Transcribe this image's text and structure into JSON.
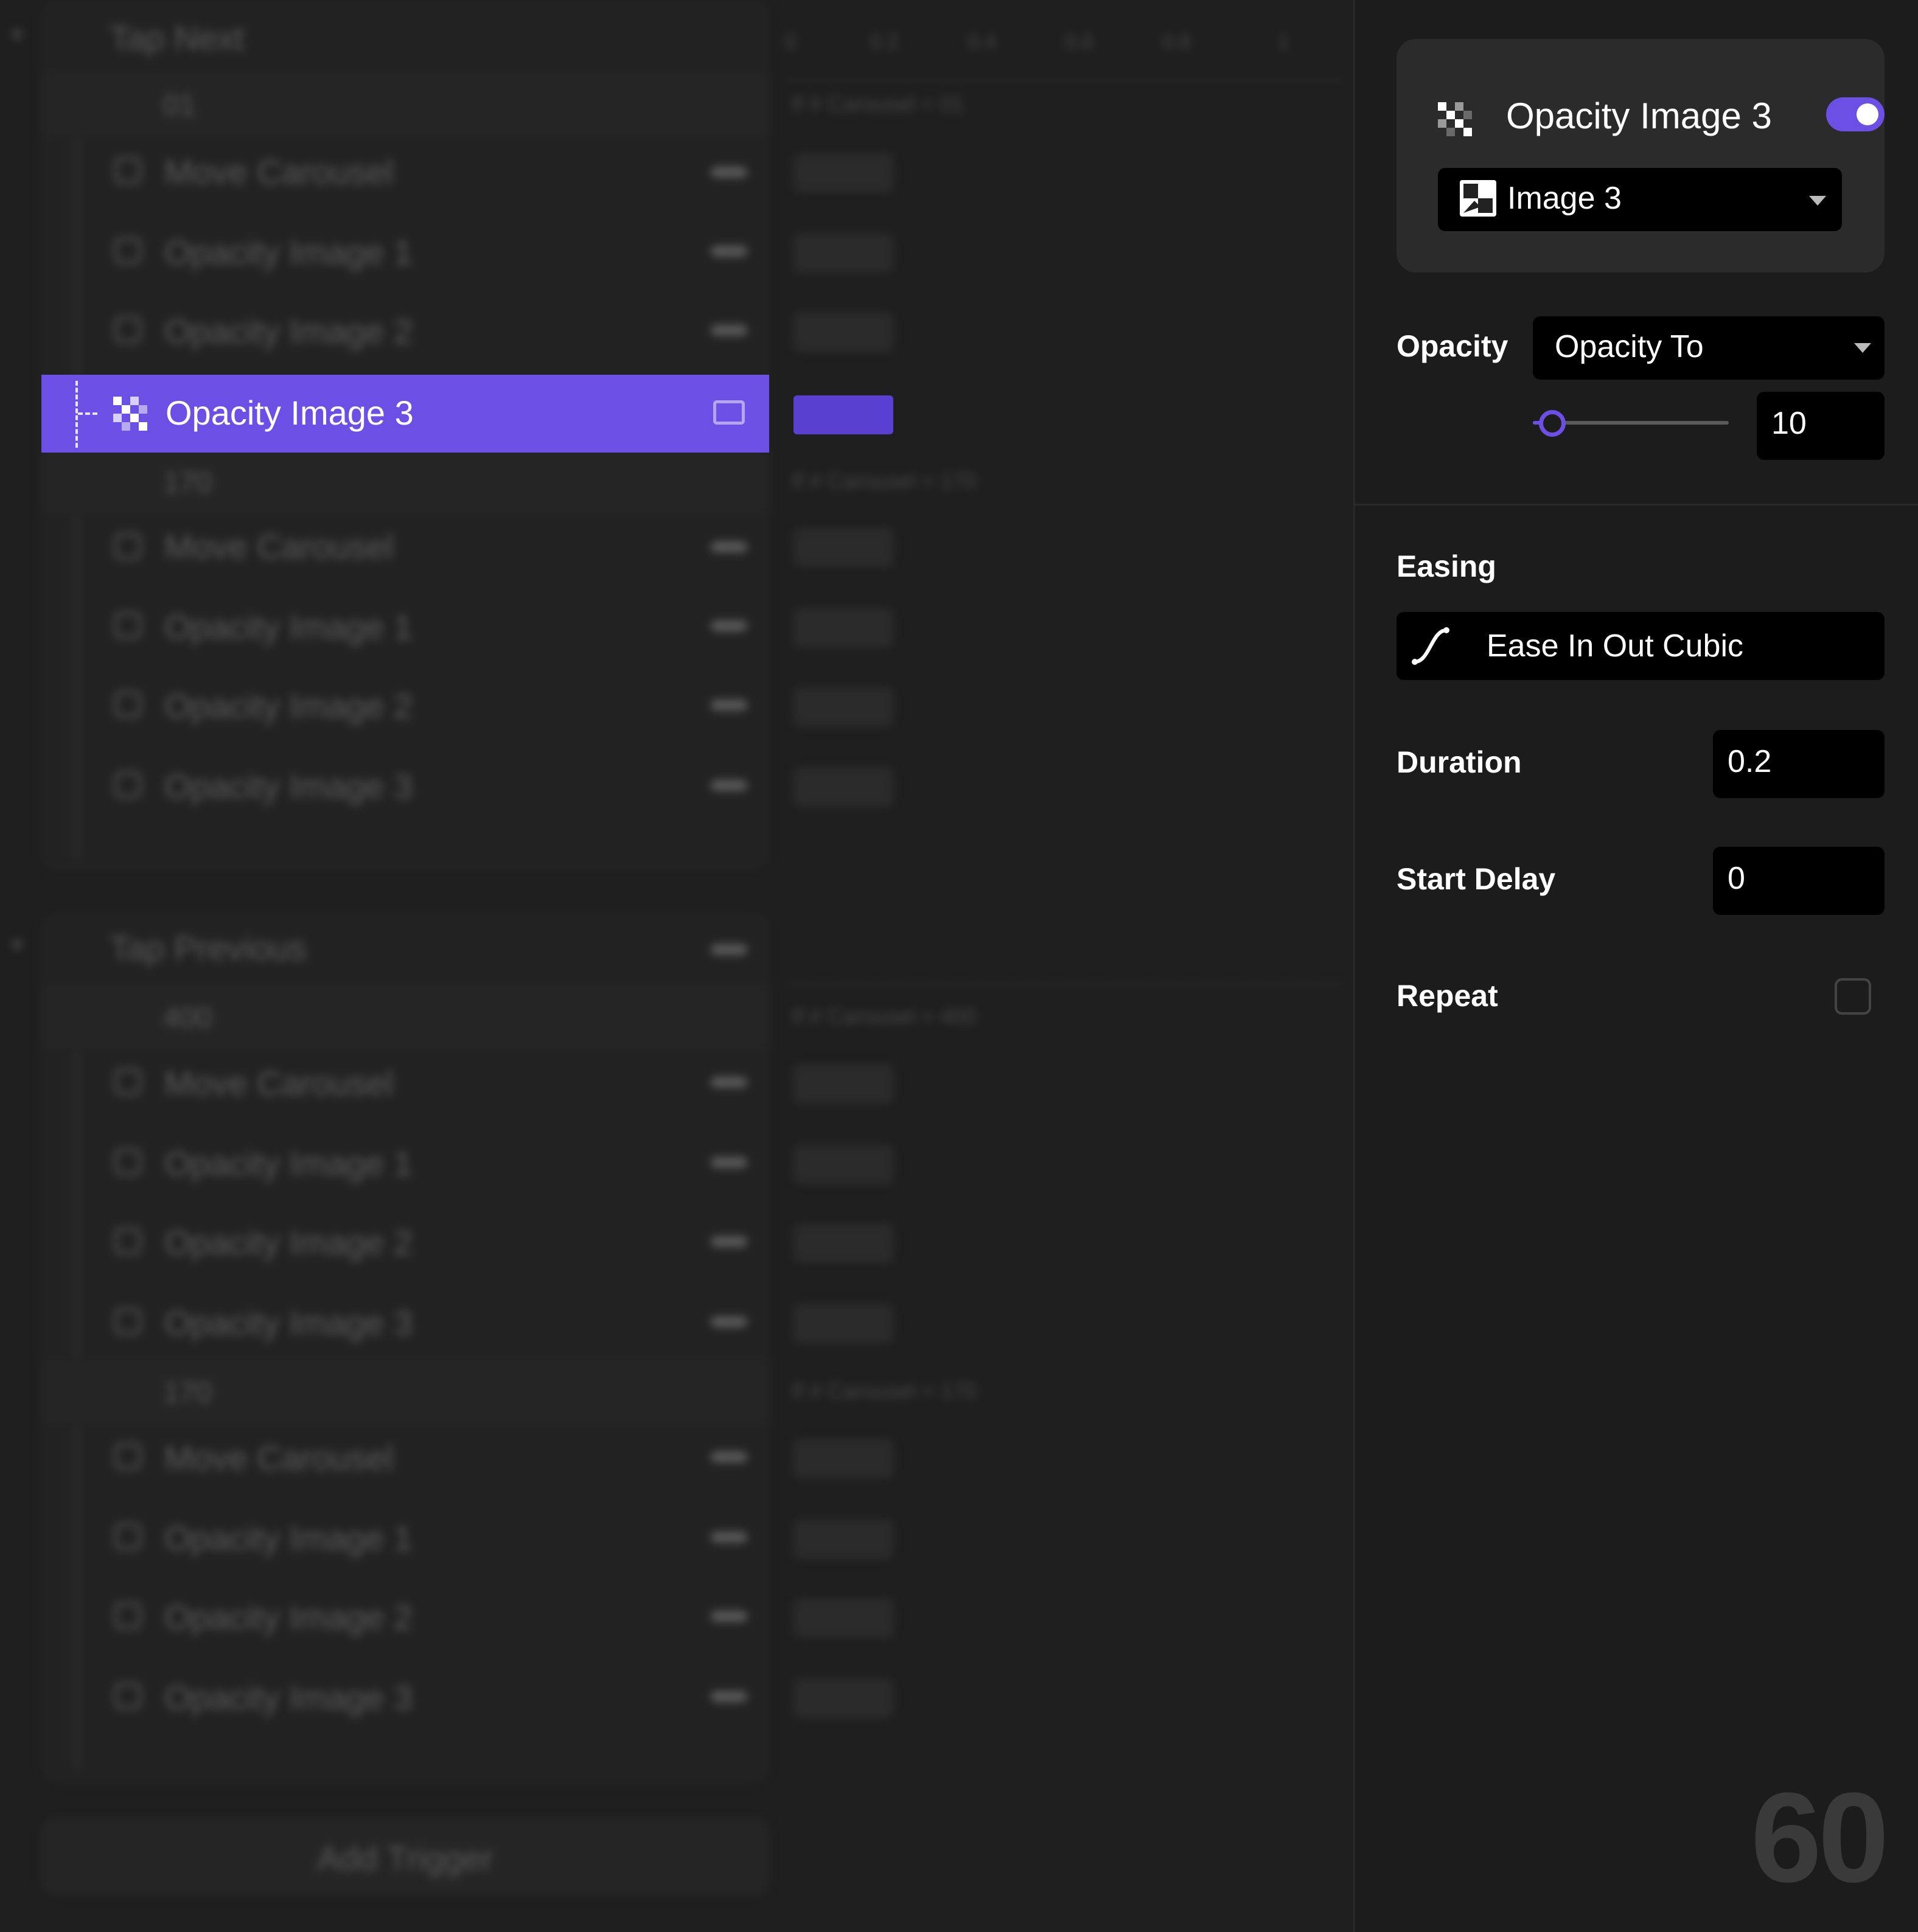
{
  "timeline": {
    "ruler_ticks": [
      "0",
      "0.2",
      "0.4",
      "0.6",
      "0.8",
      "1"
    ],
    "triggers": [
      {
        "title": "Tap Next",
        "states": [
          {
            "label": "01",
            "summary": "If # Carousel = 01",
            "actions": [
              "Move Carousel",
              "Opacity Image 1",
              "Opacity Image 2",
              "Opacity Image 3"
            ]
          },
          {
            "label": "170",
            "summary": "If # Carousel = 170",
            "actions": [
              "Move Carousel",
              "Opacity Image 1",
              "Opacity Image 2",
              "Opacity Image 3"
            ]
          }
        ]
      },
      {
        "title": "Tap Previous",
        "states": [
          {
            "label": "400",
            "summary": "If # Carousel = 400",
            "actions": [
              "Move Carousel",
              "Opacity Image 1",
              "Opacity Image 2",
              "Opacity Image 3"
            ]
          },
          {
            "label": "170",
            "summary": "If # Carousel = 170",
            "actions": [
              "Move Carousel",
              "Opacity Image 1",
              "Opacity Image 2",
              "Opacity Image 3"
            ]
          }
        ]
      }
    ],
    "selected_action": "Opacity Image 3",
    "add_trigger_label": "Add Trigger"
  },
  "inspector": {
    "action_title": "Opacity Image 3",
    "enabled": true,
    "target": "Image 3",
    "opacity_label": "Opacity",
    "opacity_mode": "Opacity To",
    "opacity_value": "10",
    "opacity_fraction": 0.1,
    "easing_label": "Easing",
    "easing_value": "Ease In Out Cubic",
    "duration_label": "Duration",
    "duration_value": "0.2",
    "start_delay_label": "Start Delay",
    "start_delay_value": "0",
    "repeat_label": "Repeat",
    "repeat_checked": false
  },
  "fps": "60",
  "colors": {
    "accent": "#6c50e6",
    "background": "#1c1c1c",
    "panel": "#2b2b2b"
  }
}
